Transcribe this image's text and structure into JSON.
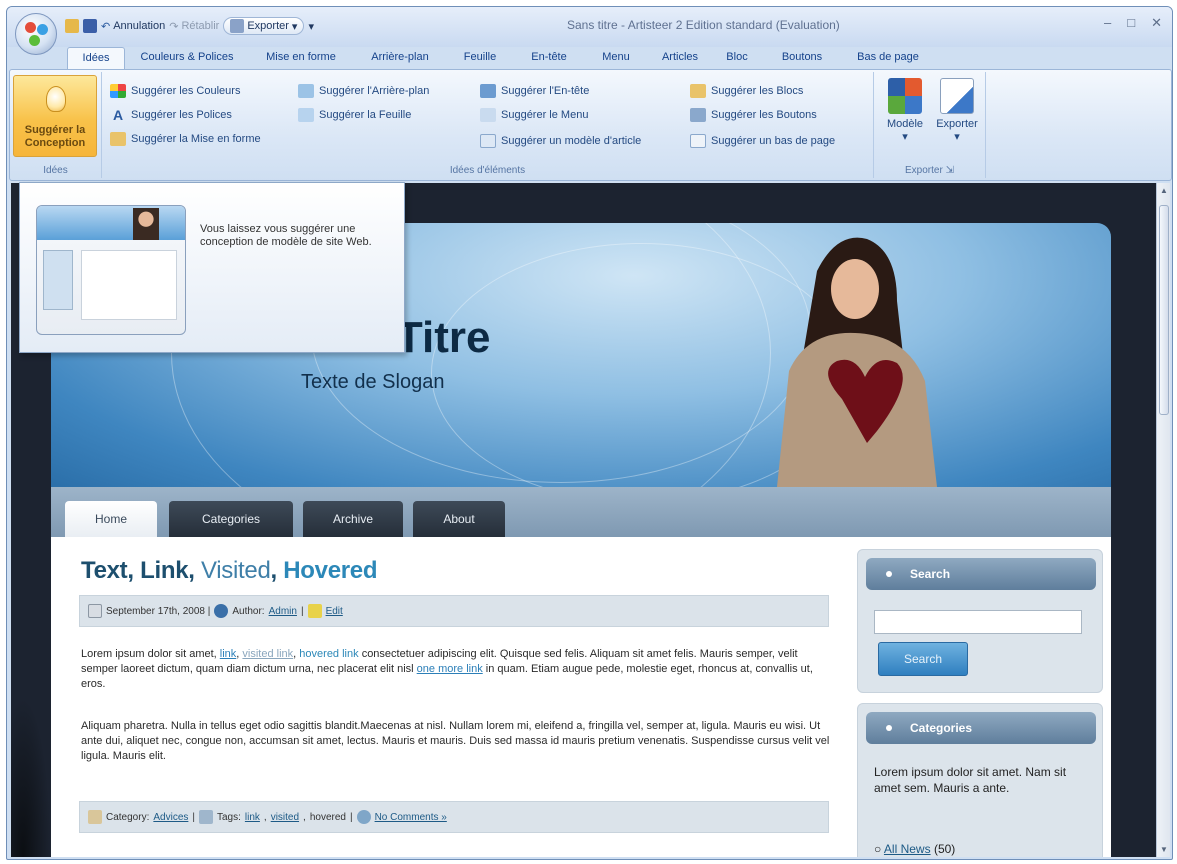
{
  "app": {
    "title": "Sans titre - Artisteer 2 Edition standard (Evaluation)",
    "controls": {
      "minimize": "–",
      "maximize": "□",
      "close": "✕"
    }
  },
  "qat": {
    "undo": "Annulation",
    "redo": "Rétablir",
    "export": "Exporter",
    "export_arrow": "▾",
    "customize": "▾"
  },
  "tabs": [
    "Idées",
    "Couleurs & Polices",
    "Mise en forme",
    "Arrière-plan",
    "Feuille",
    "En-tête",
    "Menu",
    "Articles",
    "Bloc",
    "Boutons",
    "Bas de page"
  ],
  "ribbon": {
    "big_button": {
      "line1": "Suggérer la",
      "line2": "Conception"
    },
    "group1_label": "Idées",
    "col1": [
      "Suggérer les Couleurs",
      "Suggérer les Polices",
      "Suggérer la Mise en forme"
    ],
    "col2": [
      "Suggérer l'Arrière-plan",
      "Suggérer la Feuille"
    ],
    "col3": [
      "Suggérer l'En-tête",
      "Suggérer le Menu",
      "Suggérer un modèle d'article"
    ],
    "col4": [
      "Suggérer les Blocs",
      "Suggérer les Boutons",
      "Suggérer un bas de page"
    ],
    "group2_label": "Idées d'éléments",
    "export_group": {
      "model": "Modèle",
      "export": "Exporter",
      "label": "Exporter",
      "arrow": "▾",
      "launcher": "⇲"
    }
  },
  "popup": {
    "text": "Vous laissez vous suggérer une conception de modèle de site Web."
  },
  "site": {
    "title": "Gros Titre",
    "slogan": "Texte de Slogan",
    "nav": [
      "Home",
      "Categories",
      "Archive",
      "About"
    ],
    "post": {
      "title_parts": [
        "Text, Link, ",
        "Visited",
        ", ",
        "Hovered"
      ],
      "meta": {
        "date": "September 17th, 2008 |",
        "author_label": "Author:",
        "author": "Admin",
        "sep": "|",
        "edit": "Edit"
      },
      "p1": {
        "a": "Lorem ipsum dolor sit amet,",
        "link": "link",
        "sep1": ",",
        "visited": "visited link",
        "sep2": ",",
        "hovered": "hovered link",
        "b": "consectetuer adipiscing elit. Quisque sed felis. Aliquam sit amet felis. Mauris semper, velit semper laoreet dictum, quam diam dictum urna, nec placerat elit nisl",
        "more": "one more link",
        "c": "in quam. Etiam augue pede, molestie eget, rhoncus at, convallis ut, eros."
      },
      "p2": "Aliquam pharetra. Nulla in tellus eget odio sagittis blandit.Maecenas at nisl. Nullam lorem mi, eleifend a, fringilla vel, semper at, ligula. Mauris eu wisi. Ut ante dui, aliquet nec, congue non, accumsan sit amet, lectus. Mauris et mauris. Duis sed massa id mauris pretium venenatis. Suspendisse cursus velit vel ligula. Mauris elit.",
      "footer": {
        "category_label": "Category:",
        "category": "Advices",
        "sep": "|",
        "tags_label": "Tags:",
        "tag1": "link",
        "tag2": "visited",
        "tag3": "hovered",
        "comments": "No Comments »"
      }
    },
    "sidebar": {
      "search_title": "Search",
      "search_button": "Search",
      "categories_title": "Categories",
      "categories_text": "Lorem ipsum dolor sit amet. Nam sit amet sem. Mauris a ante.",
      "category_item": "All News",
      "category_count": "(50)"
    }
  },
  "colors": {
    "accent": "#2c88b8",
    "ribbon": "#dbe7f6",
    "big_button": "#f8c24a"
  }
}
